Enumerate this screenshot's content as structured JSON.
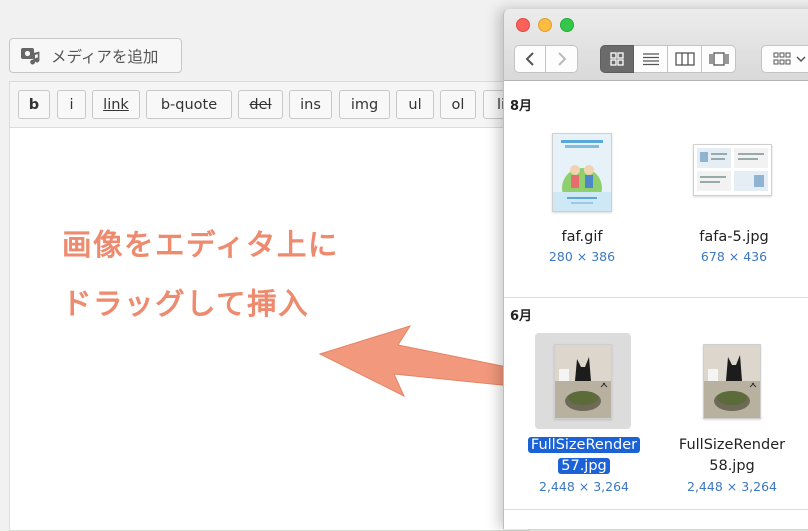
{
  "editor": {
    "add_media_label": "メディアを追加",
    "quicktags": [
      "b",
      "i",
      "link",
      "b-quote",
      "del",
      "ins",
      "img",
      "ul",
      "ol",
      "li"
    ],
    "instruction_line1": "画像をエディタ上に",
    "instruction_line2": "ドラッグして挿入",
    "accent_color": "#ee8a6d"
  },
  "finder": {
    "view_modes": [
      "icon-view",
      "list-view",
      "column-view",
      "gallery-view"
    ],
    "active_view": "icon-view",
    "sections": [
      {
        "label": "8月",
        "files": [
          {
            "name": "faf.gif",
            "dims": "280 × 386"
          },
          {
            "name": "fafa-5.jpg",
            "dims": "678 × 436"
          }
        ]
      },
      {
        "label": "6月",
        "files": [
          {
            "name_line1": "FullSizeRender",
            "name_line2": "57.jpg",
            "dims": "2,448 × 3,264",
            "selected": true
          },
          {
            "name_line1": "FullSizeRender",
            "name_line2": "58.jpg",
            "dims": "2,448 × 3,264",
            "selected": false
          }
        ]
      }
    ],
    "selection_color": "#1a62d5"
  }
}
